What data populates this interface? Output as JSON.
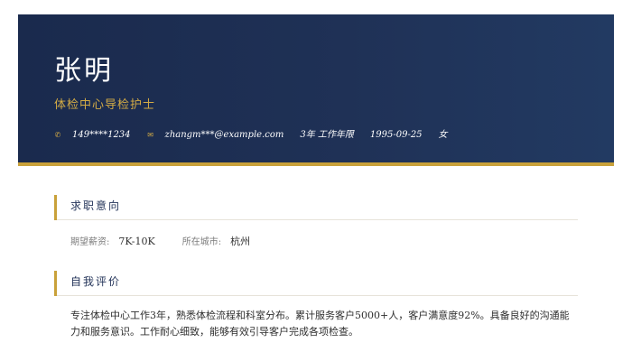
{
  "header": {
    "name": "张明",
    "title": "体检中心导检护士",
    "contacts": [
      {
        "icon": "phone-icon",
        "symbol": "✆",
        "value": "149****1234"
      },
      {
        "icon": "mail-icon",
        "symbol": "✉",
        "value": "zhangm***@example.com"
      },
      {
        "value": "3年 工作年限"
      },
      {
        "value": "1995-09-25"
      },
      {
        "value": "女"
      }
    ]
  },
  "sections": {
    "intent": {
      "title": "求职意向",
      "salary_label": "期望薪资:",
      "salary_value": "7K-10K",
      "city_label": "所在城市:",
      "city_value": "杭州"
    },
    "summary": {
      "title": "自我评价",
      "text": "专注体检中心工作3年，熟悉体检流程和科室分布。累计服务客户5000+人，客户满意度92%。具备良好的沟通能力和服务意识。工作耐心细致，能够有效引导客户完成各项检查。"
    }
  },
  "colors": {
    "header_bg": "#1f3156",
    "accent": "#c9a13a",
    "title_gold": "#d4ac45",
    "text_dark": "#2f2f2f"
  }
}
